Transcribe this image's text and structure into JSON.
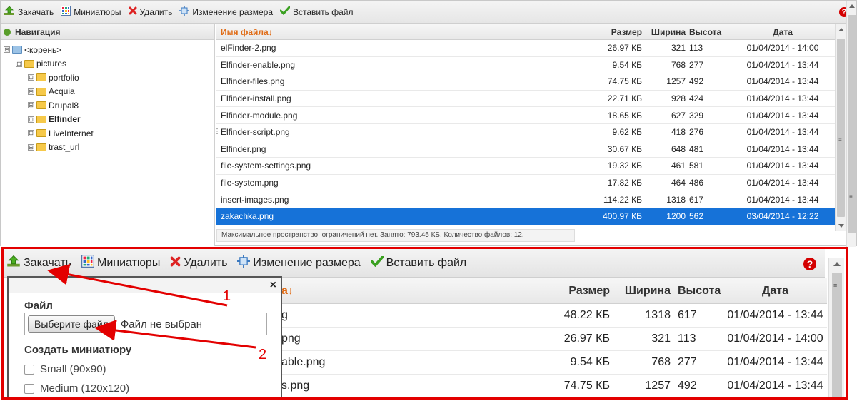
{
  "toolbar": {
    "upload": "Закачать",
    "thumbnails": "Миниатюры",
    "delete": "Удалить",
    "resize": "Изменение размера",
    "paste": "Вставить файл",
    "help": "?"
  },
  "nav": {
    "title": "Навигация",
    "tree": [
      {
        "label": "<корень>",
        "toggle": "⊟",
        "level": 0,
        "bold": false,
        "root": true
      },
      {
        "label": "pictures",
        "toggle": "⊟",
        "level": 1,
        "bold": false
      },
      {
        "label": "portfolio",
        "toggle": "⊡",
        "level": 2,
        "bold": false
      },
      {
        "label": "Acquia",
        "toggle": "⊞",
        "level": 2,
        "bold": false
      },
      {
        "label": "Drupal8",
        "toggle": "⊞",
        "level": 2,
        "bold": false
      },
      {
        "label": "Elfinder",
        "toggle": "⊡",
        "level": 2,
        "bold": true
      },
      {
        "label": "LiveInternet",
        "toggle": "⊞",
        "level": 2,
        "bold": false
      },
      {
        "label": "trast_url",
        "toggle": "⊞",
        "level": 2,
        "bold": false
      }
    ]
  },
  "columns": {
    "name": "Имя файла↓",
    "size": "Размер",
    "width": "Ширина",
    "height": "Высота",
    "date": "Дата"
  },
  "files": [
    {
      "name": "elFinder-2.png",
      "size": "26.97 КБ",
      "w": "321",
      "h": "113",
      "date": "01/04/2014 - 14:00"
    },
    {
      "name": "Elfinder-enable.png",
      "size": "9.54 КБ",
      "w": "768",
      "h": "277",
      "date": "01/04/2014 - 13:44"
    },
    {
      "name": "Elfinder-files.png",
      "size": "74.75 КБ",
      "w": "1257",
      "h": "492",
      "date": "01/04/2014 - 13:44"
    },
    {
      "name": "Elfinder-install.png",
      "size": "22.71 КБ",
      "w": "928",
      "h": "424",
      "date": "01/04/2014 - 13:44"
    },
    {
      "name": "Elfinder-module.png",
      "size": "18.65 КБ",
      "w": "627",
      "h": "329",
      "date": "01/04/2014 - 13:44"
    },
    {
      "name": "Elfinder-script.png",
      "size": "9.62 КБ",
      "w": "418",
      "h": "276",
      "date": "01/04/2014 - 13:44"
    },
    {
      "name": "Elfinder.png",
      "size": "30.67 КБ",
      "w": "648",
      "h": "481",
      "date": "01/04/2014 - 13:44"
    },
    {
      "name": "file-system-settings.png",
      "size": "19.32 КБ",
      "w": "461",
      "h": "581",
      "date": "01/04/2014 - 13:44"
    },
    {
      "name": "file-system.png",
      "size": "17.82 КБ",
      "w": "464",
      "h": "486",
      "date": "01/04/2014 - 13:44"
    },
    {
      "name": "insert-images.png",
      "size": "114.22 КБ",
      "w": "1318",
      "h": "617",
      "date": "01/04/2014 - 13:44"
    },
    {
      "name": "zakachka.png",
      "size": "400.97 КБ",
      "w": "1200",
      "h": "562",
      "date": "03/04/2014 - 12:22",
      "selected": true
    }
  ],
  "status": "Максимальное пространство: ограничений нет. Занято: 793.45 КБ. Количество файлов: 12.",
  "zoom": {
    "header_name_partial": "a↓",
    "rows": [
      {
        "name": "g",
        "size": "48.22 КБ",
        "w": "1318",
        "h": "617",
        "date": "01/04/2014 - 13:44"
      },
      {
        "name": "png",
        "size": "26.97 КБ",
        "w": "321",
        "h": "113",
        "date": "01/04/2014 - 14:00"
      },
      {
        "name": "able.png",
        "size": "9.54 КБ",
        "w": "768",
        "h": "277",
        "date": "01/04/2014 - 13:44"
      },
      {
        "name": "s.png",
        "size": "74.75 КБ",
        "w": "1257",
        "h": "492",
        "date": "01/04/2014 - 13:44"
      }
    ],
    "dialog": {
      "close": "×",
      "file_label": "Файл",
      "choose_button": "Выберите файл",
      "no_file": "Файл не выбран",
      "thumbs_label": "Создать миниатюру",
      "options": [
        "Small (90x90)",
        "Medium (120x120)"
      ]
    },
    "annotations": [
      "1",
      "2"
    ]
  },
  "colors": {
    "selection": "#1672d8",
    "annotation": "#e30000",
    "sort_header": "#e06c17"
  }
}
